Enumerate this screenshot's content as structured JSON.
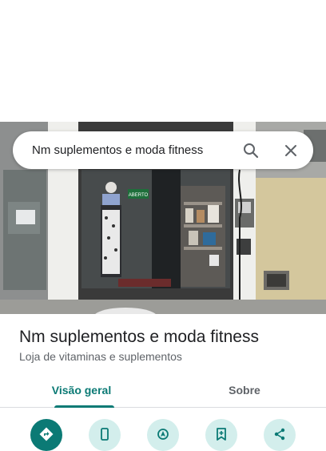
{
  "search": {
    "query": "Nm suplementos e moda fitness",
    "search_icon": "search-icon",
    "close_icon": "close-icon"
  },
  "photo": {
    "sign_text": "ABERTO"
  },
  "place": {
    "name": "Nm suplementos e moda fitness",
    "category": "Loja de vitaminas e suplementos"
  },
  "tabs": [
    {
      "label": "Visão geral",
      "selected": true
    },
    {
      "label": "Sobre",
      "selected": false
    }
  ],
  "actions": [
    {
      "icon": "directions-icon"
    },
    {
      "icon": "call-icon"
    },
    {
      "icon": "start-navigation-icon"
    },
    {
      "icon": "save-icon"
    },
    {
      "icon": "share-icon"
    }
  ],
  "colors": {
    "accent": "#0b7a75",
    "accent_light": "#d3eeec",
    "text_primary": "#202124",
    "text_secondary": "#5f6368"
  }
}
